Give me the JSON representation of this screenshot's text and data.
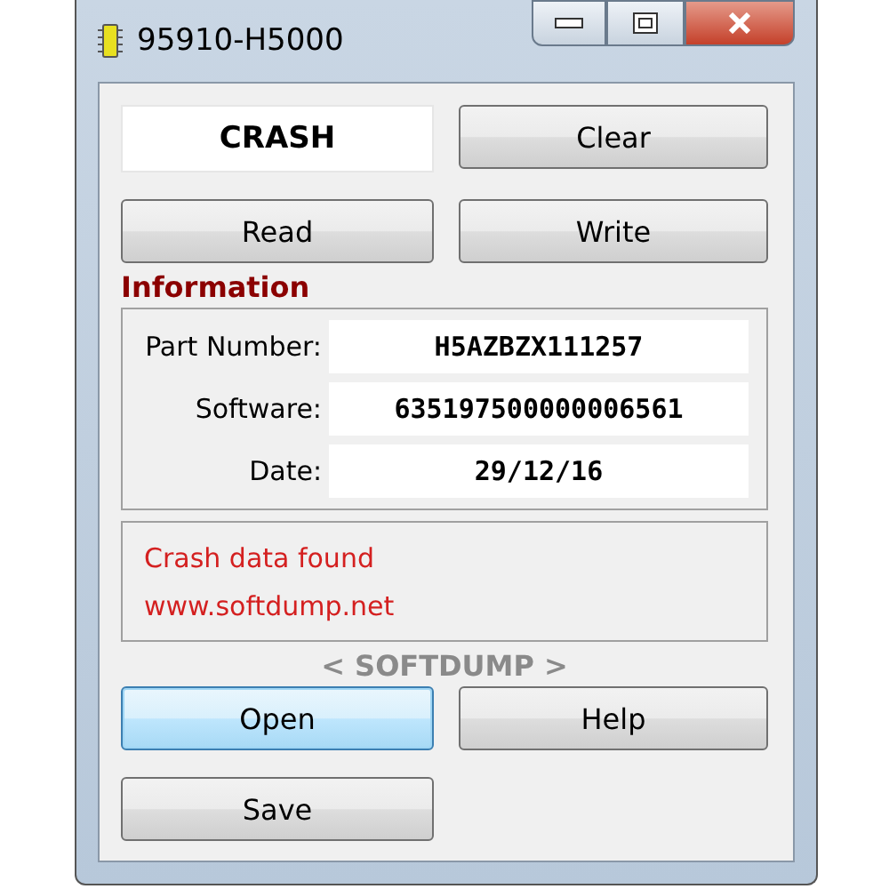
{
  "window": {
    "title": "95910-H5000"
  },
  "mode_field": {
    "value": "CRASH"
  },
  "top_buttons": [
    {
      "label": "Clear",
      "focused": false
    },
    {
      "label": "Read",
      "focused": false
    },
    {
      "label": "Write",
      "focused": false
    }
  ],
  "information": {
    "title": "Information",
    "fields": [
      {
        "label": "Part Number:",
        "value": "H5AZBZX111257"
      },
      {
        "label": "Software:",
        "value": "635197500000006561"
      },
      {
        "label": "Date:",
        "value": "29/12/16"
      }
    ]
  },
  "messages": [
    "Crash data found",
    "www.softdump.net"
  ],
  "brand": "< SOFTDUMP >",
  "bottom_buttons": [
    {
      "label": "Open",
      "focused": true
    },
    {
      "label": "Help",
      "focused": false
    },
    {
      "label": "Save",
      "focused": false
    }
  ]
}
